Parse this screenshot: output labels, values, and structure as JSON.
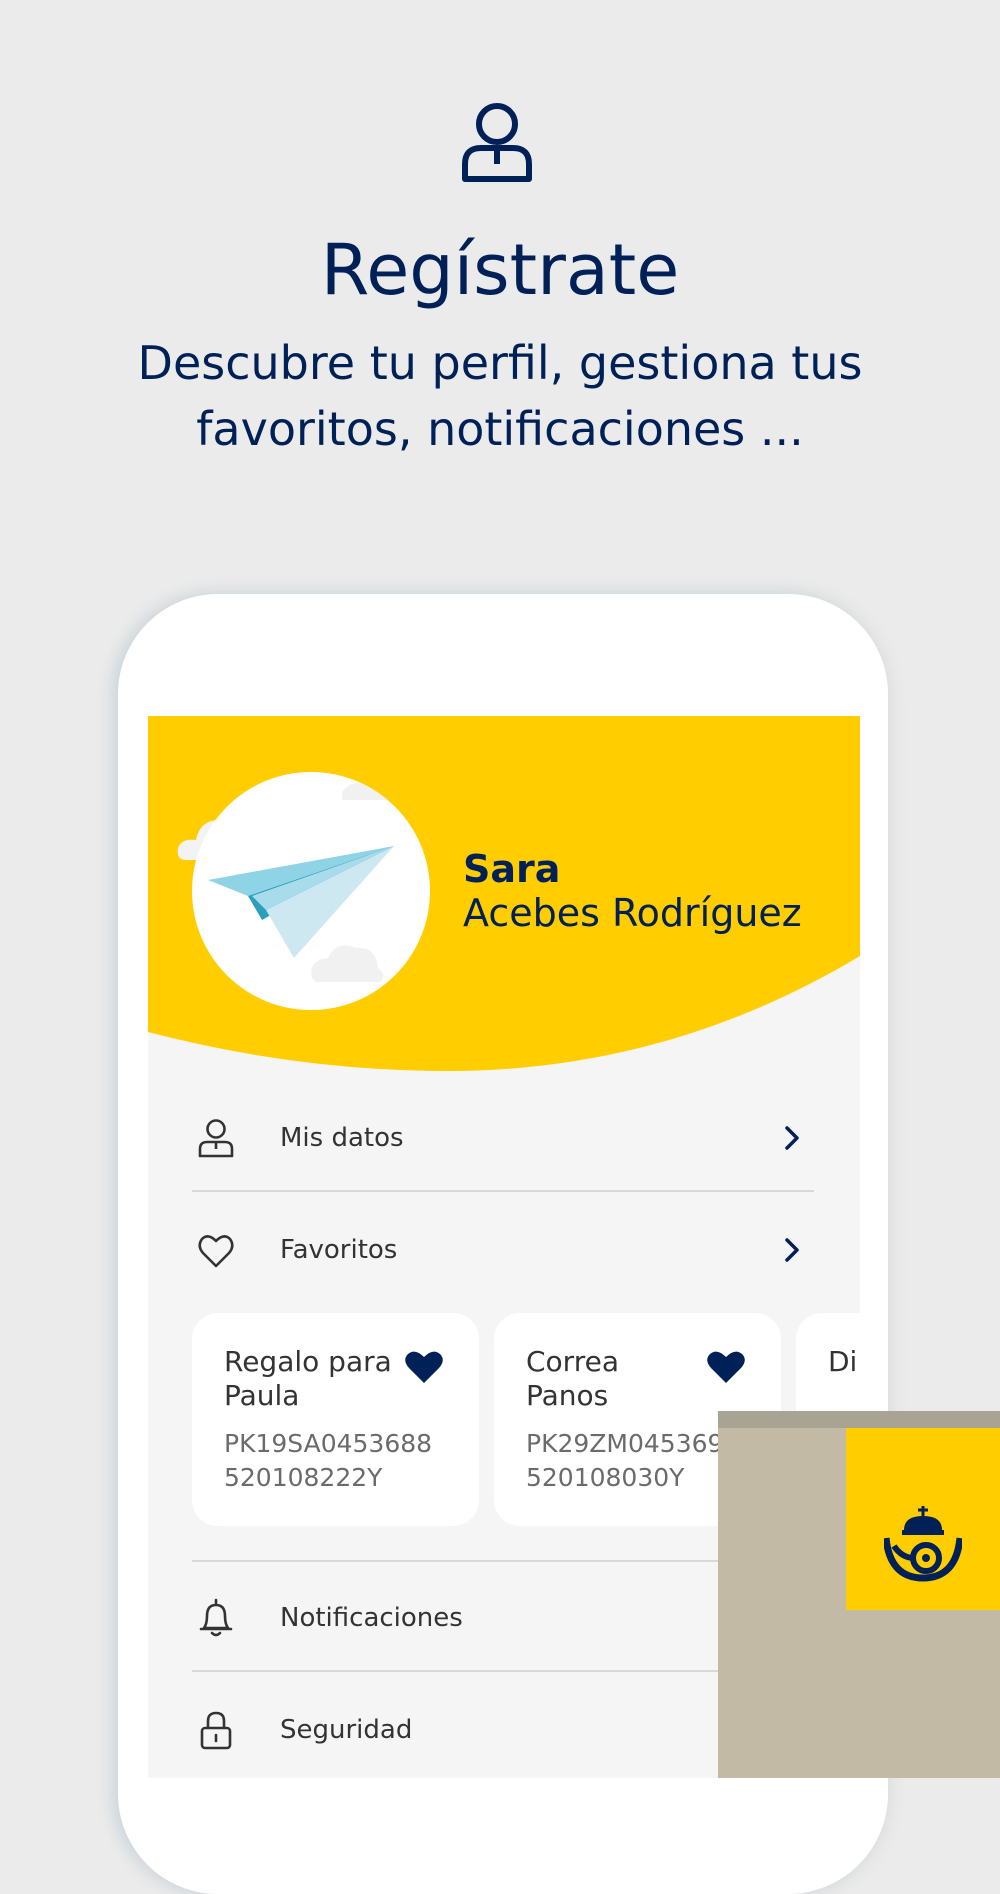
{
  "hero": {
    "icon": "user-icon",
    "title": "Regístrate",
    "subtitle": "Descubre tu perfil, gestiona tus favoritos, notificaciones ..."
  },
  "profile": {
    "first_name": "Sara",
    "last_name": "Acebes Rodríguez",
    "avatar_icon": "paper-plane-icon"
  },
  "menu": {
    "mis_datos": {
      "label": "Mis datos",
      "icon": "user-icon"
    },
    "favoritos": {
      "label": "Favoritos",
      "icon": "heart-outline-icon"
    },
    "notificaciones": {
      "label": "Notificaciones",
      "icon": "bell-icon"
    },
    "seguridad": {
      "label": "Seguridad",
      "icon": "lock-icon"
    }
  },
  "favorites": [
    {
      "name": "Regalo para Paula",
      "code": "PK19SA0453688\n520108222Y"
    },
    {
      "name": "Correa Panos",
      "code": "PK29ZM045369\n520108030Y"
    },
    {
      "name": "Di en",
      "code": ""
    }
  ],
  "colors": {
    "brand_blue": "#002157",
    "brand_yellow": "#ffcd00",
    "background": "#ebebeb"
  }
}
